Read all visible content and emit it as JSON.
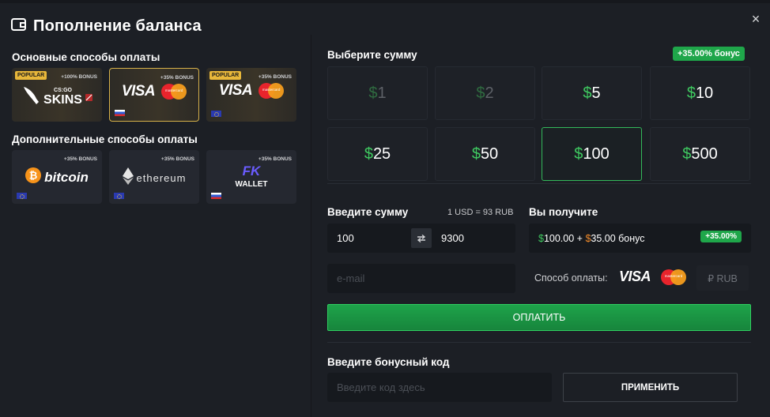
{
  "header": {
    "title": "Пополнение баланса",
    "close_label": "×"
  },
  "left": {
    "main_methods_label": "Основные способы оплаты",
    "extra_methods_label": "Дополнительные способы оплаты",
    "main_methods": [
      {
        "popular": "POPULAR",
        "bonus": "+100% BONUS",
        "logo_small": "CS:GO",
        "logo": "SKINS",
        "flag": "none"
      },
      {
        "bonus": "+35% BONUS",
        "logo": "VISA",
        "mc_text": "mastercard",
        "flag": "ru",
        "selected": true
      },
      {
        "popular": "POPULAR",
        "bonus": "+35% BONUS",
        "logo": "VISA",
        "mc_text": "mastercard",
        "flag": "eu"
      }
    ],
    "extra_methods": [
      {
        "bonus": "+35% BONUS",
        "logo": "bitcoin",
        "flag": "eu"
      },
      {
        "bonus": "+35% BONUS",
        "logo": "ethereum",
        "flag": "eu"
      },
      {
        "bonus": "+35% BONUS",
        "logo_small": "FK",
        "logo": "WALLET",
        "flag": "ru"
      }
    ]
  },
  "right": {
    "choose_label": "Выберите сумму",
    "bonus_badge": "+35.00% бонус",
    "amounts": [
      {
        "cur": "$",
        "num": "1",
        "state": "dim"
      },
      {
        "cur": "$",
        "num": "2",
        "state": "dim"
      },
      {
        "cur": "$",
        "num": "5",
        "state": "normal"
      },
      {
        "cur": "$",
        "num": "10",
        "state": "normal"
      },
      {
        "cur": "$",
        "num": "25",
        "state": "normal"
      },
      {
        "cur": "$",
        "num": "50",
        "state": "normal"
      },
      {
        "cur": "$",
        "num": "100",
        "state": "active"
      },
      {
        "cur": "$",
        "num": "500",
        "state": "normal"
      }
    ],
    "enter_label": "Введите сумму",
    "rate": "1 USD = 93 RUB",
    "usd_value": "100",
    "rub_value": "9300",
    "receive_label": "Вы получите",
    "receive": {
      "usd_cur": "$",
      "usd": "100.00",
      "plus": " + ",
      "bonus_cur": "$",
      "bonus": "35.00",
      "word": " бонус",
      "badge": "+35.00%"
    },
    "email_placeholder": "e-mail",
    "method_label": "Способ оплаты:",
    "method_visa": "VISA",
    "method_mc": "mastercard",
    "currency": "₽ RUB",
    "pay_label": "ОПЛАТИТЬ",
    "promo_label": "Введите бонусный код",
    "promo_placeholder": "Введите код здесь",
    "apply_label": "ПРИМЕНИТЬ"
  },
  "colors": {
    "accent_green": "#1fa64a",
    "gold": "#d6b14a",
    "bg": "#1c1f25"
  }
}
